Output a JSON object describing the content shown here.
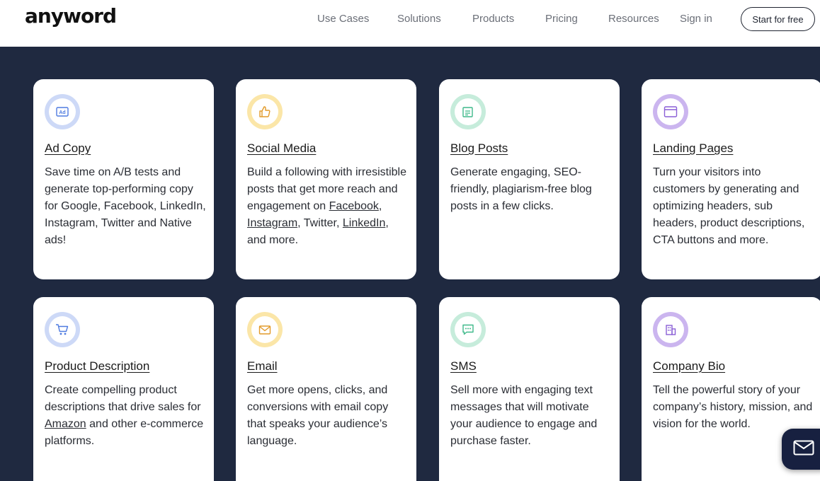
{
  "header": {
    "logo": "anyword",
    "nav": [
      "Use Cases",
      "Solutions",
      "Products",
      "Pricing",
      "Resources",
      "Sign in"
    ],
    "cta": "Start for free"
  },
  "cards": [
    {
      "title": "Ad Copy",
      "desc": "Save time on A/B tests and generate top-performing copy for Google, Facebook, LinkedIn, Instagram, Twitter and Native ads!",
      "icon": "ad-icon",
      "ring": "#cdd9f7",
      "stroke": "#4f7be0"
    },
    {
      "title": "Social Media",
      "desc_parts": [
        "Build a following with irresistible posts that get more reach and engagement on ",
        "Facebook",
        ", ",
        "Instagram",
        ", Twitter, ",
        "LinkedIn",
        ", and more."
      ],
      "icon": "thumbs-up-icon",
      "ring": "#fbe6a8",
      "stroke": "#e29a2a"
    },
    {
      "title": "Blog Posts",
      "desc": "Generate engaging, SEO-friendly, plagiarism-free blog posts in a few clicks.",
      "icon": "blog-post-icon",
      "ring": "#c6ecdb",
      "stroke": "#3fb98a"
    },
    {
      "title": "Landing Pages",
      "desc": "Turn your visitors into customers by generating and optimizing headers, sub headers, product descriptions, CTA buttons and more.",
      "icon": "browser-window-icon",
      "ring": "#cbb5ef",
      "stroke": "#8a5fd6"
    },
    {
      "title": "Product Description",
      "desc_parts": [
        "Create compelling product descriptions that drive sales for ",
        "Amazon",
        " and other e-commerce platforms."
      ],
      "icon": "shopping-cart-icon",
      "ring": "#cdd9f7",
      "stroke": "#4f7be0"
    },
    {
      "title": "Email",
      "desc": "Get more opens, clicks, and conversions with email copy that speaks your audience’s language.",
      "icon": "envelope-icon",
      "ring": "#fbe6a8",
      "stroke": "#e29a2a"
    },
    {
      "title": "SMS",
      "desc": "Sell more with engaging text messages that will motivate your audience to engage and purchase faster.",
      "icon": "chat-bubble-icon",
      "ring": "#c6ecdb",
      "stroke": "#3fb98a"
    },
    {
      "title": "Company Bio",
      "desc": "Tell the powerful story of your company’s history, mission, and vision for the world.",
      "icon": "building-icon",
      "ring": "#cbb5ef",
      "stroke": "#8a5fd6"
    }
  ],
  "chat_widget": {
    "icon": "mail-icon"
  }
}
